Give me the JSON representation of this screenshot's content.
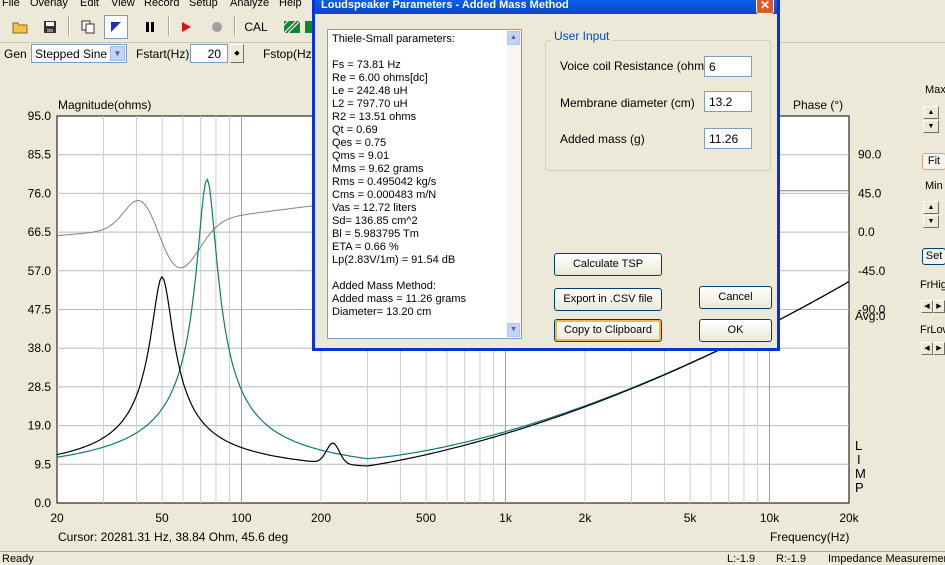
{
  "menu": [
    "File",
    "Overlay",
    "Edit",
    "View",
    "Record",
    "Setup",
    "Analyze",
    "Help"
  ],
  "toolbar": {
    "cal_label": "CAL"
  },
  "gen": {
    "gen_label": "Gen",
    "signal_value": "Stepped Sine",
    "fstart_label": "Fstart(Hz)",
    "fstart_value": "20",
    "fstop_label": "Fstop(Hz)"
  },
  "plot": {
    "y_left_label": "Magnitude(ohms)",
    "y_right_label": "Phase (°)",
    "x_label": "Frequency(Hz)",
    "cursor_text": "Cursor: 20281.31 Hz, 38.84 Ohm, 45.6 deg",
    "avg_text": "Avg:0",
    "limp_letters": [
      "L",
      "I",
      "M",
      "P"
    ],
    "y_left_ticks": [
      "95.0",
      "85.5",
      "76.0",
      "66.5",
      "57.0",
      "47.5",
      "38.0",
      "28.5",
      "19.0",
      "9.5",
      "0.0"
    ],
    "y_right_ticks": [
      "90.0",
      "45.0",
      "0.0",
      "-45.0",
      "-90.0"
    ],
    "x_ticks": [
      "20",
      "50",
      "100",
      "200",
      "500",
      "1k",
      "2k",
      "5k",
      "10k",
      "20k"
    ]
  },
  "right_panel": {
    "max_label": "Max",
    "fit_label": "Fit",
    "min_label": "Min",
    "set_label": "Set",
    "frhigh_label": "FrHig",
    "frlow_label": "FrLow"
  },
  "status": {
    "ready": "Ready",
    "l_value": "L:-1.9",
    "r_value": "R:-1.9",
    "mode": "Impedance Measurement"
  },
  "dialog": {
    "title": "Loudspeaker Parameters - Added Mass Method",
    "close_glyph": "✕",
    "tsp_lines": [
      "Thiele-Small parameters:",
      "",
      "Fs  = 73.81 Hz",
      "Re  = 6.00 ohms[dc]",
      "Le  = 242.48 uH",
      "L2  = 797.70 uH",
      "R2  = 13.51 ohms",
      "Qt  = 0.69",
      "Qes = 0.75",
      "Qms = 9.01",
      "Mms = 9.62 grams",
      "Rms = 0.495042 kg/s",
      "Cms = 0.000483 m/N",
      "Vas = 12.72 liters",
      "Sd= 136.85 cm^2",
      "Bl  = 5.983795 Tm",
      "ETA = 0.66 %",
      "Lp(2.83V/1m) = 91.54 dB",
      "",
      "Added Mass Method:",
      "Added mass = 11.26 grams",
      "Diameter= 13.20 cm"
    ],
    "group_title": "User Input",
    "voice_coil_label": "Voice coil Resistance (ohms)",
    "voice_coil_value": "6",
    "membrane_label": "Membrane diameter (cm)",
    "membrane_value": "13.2",
    "added_mass_label": "Added mass (g)",
    "added_mass_value": "11.26",
    "calc_button": "Calculate TSP",
    "export_button": "Export in .CSV file",
    "copy_button": "Copy to Clipboard",
    "cancel_button": "Cancel",
    "ok_button": "OK"
  },
  "colors": {
    "magnitude_trace": "#000000",
    "added_mass_trace": "#0e7a7a",
    "phase_trace": "#808080",
    "dialog_title": "#0a5fe8"
  }
}
